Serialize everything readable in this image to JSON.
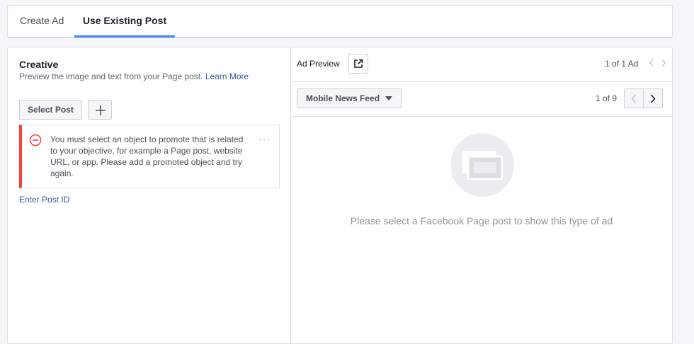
{
  "tabs": {
    "create_ad": "Create Ad",
    "use_existing_post": "Use Existing Post",
    "active": "use_existing_post"
  },
  "creative": {
    "title": "Creative",
    "subtitle": "Preview the image and text from your Page post.",
    "learn_more": "Learn More",
    "select_post_label": "Select Post",
    "add_icon": "plus-icon",
    "error": {
      "icon": "minus-circle-icon",
      "message": "You must select an object to promote that is related to your objective, for example a Page post, website URL, or app. Please add a promoted object and try again.",
      "more_label": "···"
    },
    "enter_post_id": "Enter Post ID"
  },
  "preview": {
    "label": "Ad Preview",
    "open_icon": "external-link-icon",
    "ad_count": "1 of 1 Ad",
    "placement": "Mobile News Feed",
    "page_count": "1 of 9",
    "empty_icon": "images-icon",
    "empty_message": "Please select a Facebook Page post to show this type of ad"
  },
  "colors": {
    "accent": "#4080ff",
    "link": "#365899",
    "error": "#fa3e3e",
    "border": "#dddfe2"
  }
}
